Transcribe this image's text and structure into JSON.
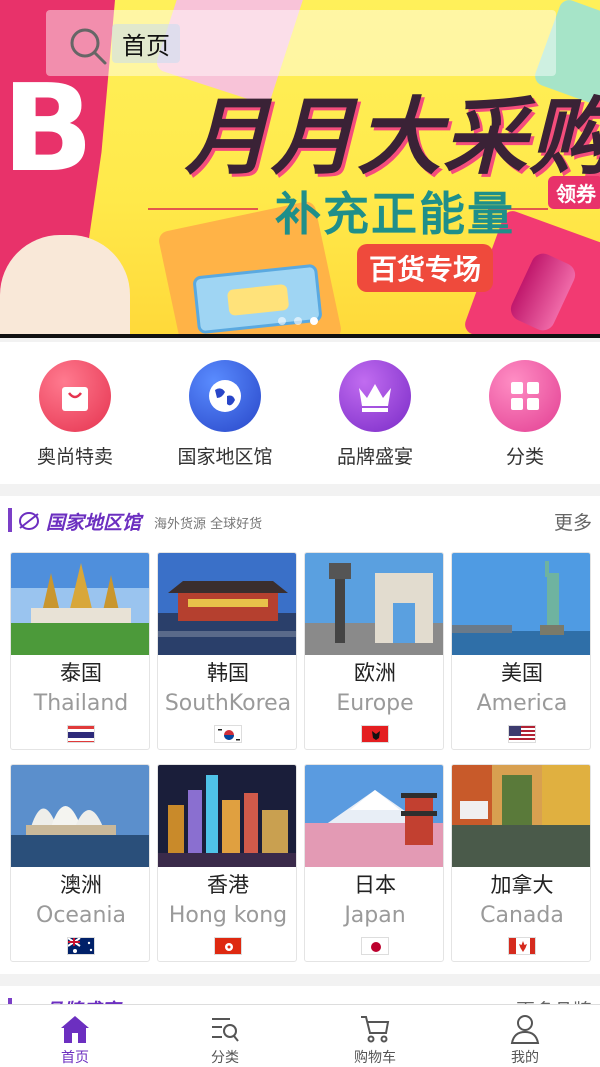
{
  "search": {
    "text": "首页"
  },
  "banner": {
    "headline": "月月大采购",
    "subline": "补充正能量",
    "tag_coupon": "领券",
    "tag_event": "百货专场",
    "big_letter": "B",
    "slide_count": 3,
    "active_slide": 2
  },
  "quick_entries": [
    {
      "label": "奥尚特卖",
      "icon": "shopping-bag-icon",
      "color": "#f04a6a"
    },
    {
      "label": "国家地区馆",
      "icon": "globe-icon",
      "color": "#3a64d8"
    },
    {
      "label": "品牌盛宴",
      "icon": "crown-icon",
      "color": "#9b3fd6"
    },
    {
      "label": "分类",
      "icon": "grid-icon",
      "color": "#f05aa8"
    }
  ],
  "country_section": {
    "title": "国家地区馆",
    "subtitle": "海外货源 全球好货",
    "more": "更多",
    "items": [
      {
        "cn": "泰国",
        "en": "Thailand",
        "flag": "thailand-flag"
      },
      {
        "cn": "韩国",
        "en": "SouthKorea",
        "flag": "south-korea-flag"
      },
      {
        "cn": "欧洲",
        "en": "Europe",
        "flag": "albania-flag"
      },
      {
        "cn": "美国",
        "en": "America",
        "flag": "usa-flag"
      },
      {
        "cn": "澳洲",
        "en": "Oceania",
        "flag": "australia-flag"
      },
      {
        "cn": "香港",
        "en": "Hong kong",
        "flag": "hong-kong-flag"
      },
      {
        "cn": "日本",
        "en": "Japan",
        "flag": "japan-flag"
      },
      {
        "cn": "加拿大",
        "en": "Canada",
        "flag": "canada-flag"
      }
    ]
  },
  "brand_section": {
    "title": "品牌盛宴",
    "more": "更多品牌"
  },
  "tabbar": [
    {
      "label": "首页",
      "icon": "home-icon",
      "active": true
    },
    {
      "label": "分类",
      "icon": "category-icon",
      "active": false
    },
    {
      "label": "购物车",
      "icon": "cart-icon",
      "active": false
    },
    {
      "label": "我的",
      "icon": "profile-icon",
      "active": false
    }
  ],
  "colors": {
    "accent": "#6c2fc0",
    "background": "#f2f2f2"
  }
}
